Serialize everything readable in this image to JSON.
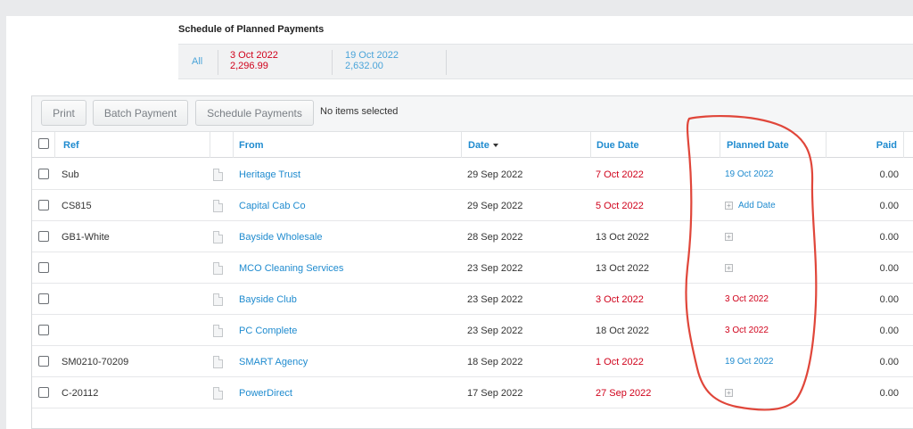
{
  "schedule": {
    "title": "Schedule of Planned Payments",
    "all_label": "All",
    "items": [
      {
        "date": "3 Oct 2022",
        "amount": "2,296.99",
        "color": "#d0021b"
      },
      {
        "date": "19 Oct 2022",
        "amount": "2,632.00",
        "color": "#4aa4d9"
      }
    ]
  },
  "toolbar": {
    "print": "Print",
    "batch_payment": "Batch Payment",
    "schedule_payments": "Schedule Payments",
    "status": "No items selected"
  },
  "columns": {
    "ref": "Ref",
    "from": "From",
    "date": "Date",
    "due_date": "Due Date",
    "planned_date": "Planned Date",
    "paid": "Paid"
  },
  "rows": [
    {
      "ref": "Sub",
      "from": "Heritage Trust",
      "date": "29 Sep 2022",
      "due": "7 Oct 2022",
      "due_overdue": true,
      "planned": "19 Oct 2022",
      "planned_color": "blue",
      "paid": "0.00"
    },
    {
      "ref": "CS815",
      "from": "Capital Cab Co",
      "date": "29 Sep 2022",
      "due": "5 Oct 2022",
      "due_overdue": true,
      "planned": "Add Date",
      "planned_color": "add",
      "paid": "0.00"
    },
    {
      "ref": "GB1-White",
      "from": "Bayside Wholesale",
      "date": "28 Sep 2022",
      "due": "13 Oct 2022",
      "due_overdue": false,
      "planned": "",
      "planned_color": "icon",
      "paid": "0.00"
    },
    {
      "ref": "",
      "from": "MCO Cleaning Services",
      "date": "23 Sep 2022",
      "due": "13 Oct 2022",
      "due_overdue": false,
      "planned": "",
      "planned_color": "icon",
      "paid": "0.00"
    },
    {
      "ref": "",
      "from": "Bayside Club",
      "date": "23 Sep 2022",
      "due": "3 Oct 2022",
      "due_overdue": true,
      "planned": "3 Oct 2022",
      "planned_color": "red",
      "paid": "0.00"
    },
    {
      "ref": "",
      "from": "PC Complete",
      "date": "23 Sep 2022",
      "due": "18 Oct 2022",
      "due_overdue": false,
      "planned": "3 Oct 2022",
      "planned_color": "red",
      "paid": "0.00"
    },
    {
      "ref": "SM0210-70209",
      "from": "SMART Agency",
      "date": "18 Sep 2022",
      "due": "1 Oct 2022",
      "due_overdue": true,
      "planned": "19 Oct 2022",
      "planned_color": "blue",
      "paid": "0.00"
    },
    {
      "ref": "C-20112",
      "from": "PowerDirect",
      "date": "17 Sep 2022",
      "due": "27 Sep 2022",
      "due_overdue": true,
      "planned": "",
      "planned_color": "icon",
      "paid": "0.00"
    }
  ],
  "annotation": {
    "color": "#e0463a"
  }
}
